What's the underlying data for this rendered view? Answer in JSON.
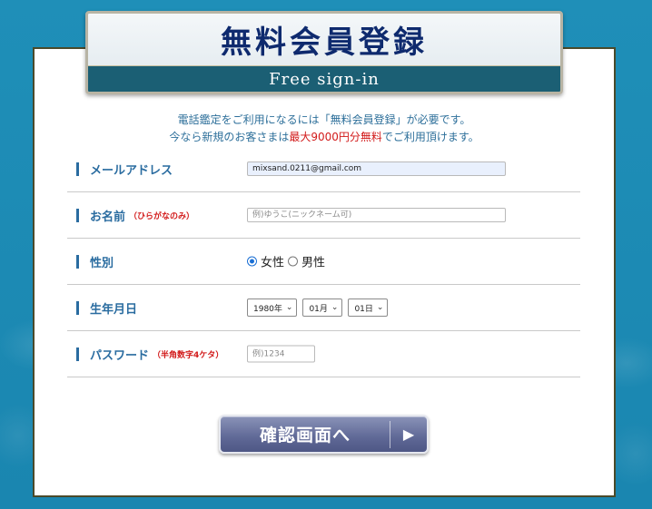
{
  "banner": {
    "title": "無料会員登録",
    "subtitle": "Free sign-in"
  },
  "intro": {
    "line1": "電話鑑定をご利用になるには「無料会員登録」が必要です。",
    "line2_pre": "今なら新規のお客さまは",
    "line2_red": "最大9000円分無料",
    "line2_post": "でご利用頂けます。"
  },
  "form": {
    "email": {
      "label": "メールアドレス",
      "value": "mixsand.0211@gmail.com"
    },
    "name": {
      "label": "お名前",
      "note": "（ひらがなのみ）",
      "placeholder": "例)ゆうこ(ニックネーム可)"
    },
    "gender": {
      "label": "性別",
      "options": [
        "女性",
        "男性"
      ],
      "selected": "女性"
    },
    "birthday": {
      "label": "生年月日",
      "year": "1980年",
      "month": "01月",
      "day": "01日"
    },
    "password": {
      "label": "パスワード",
      "note": "（半角数字4ケタ）",
      "placeholder": "例)1234"
    }
  },
  "submit": {
    "label": "確認画面へ",
    "arrow": "▶"
  },
  "colors": {
    "background": "#1d8ab3",
    "accent_blue": "#2a6ca0",
    "highlight_red": "#d21b1b",
    "banner_navy": "#0e2a6e"
  }
}
